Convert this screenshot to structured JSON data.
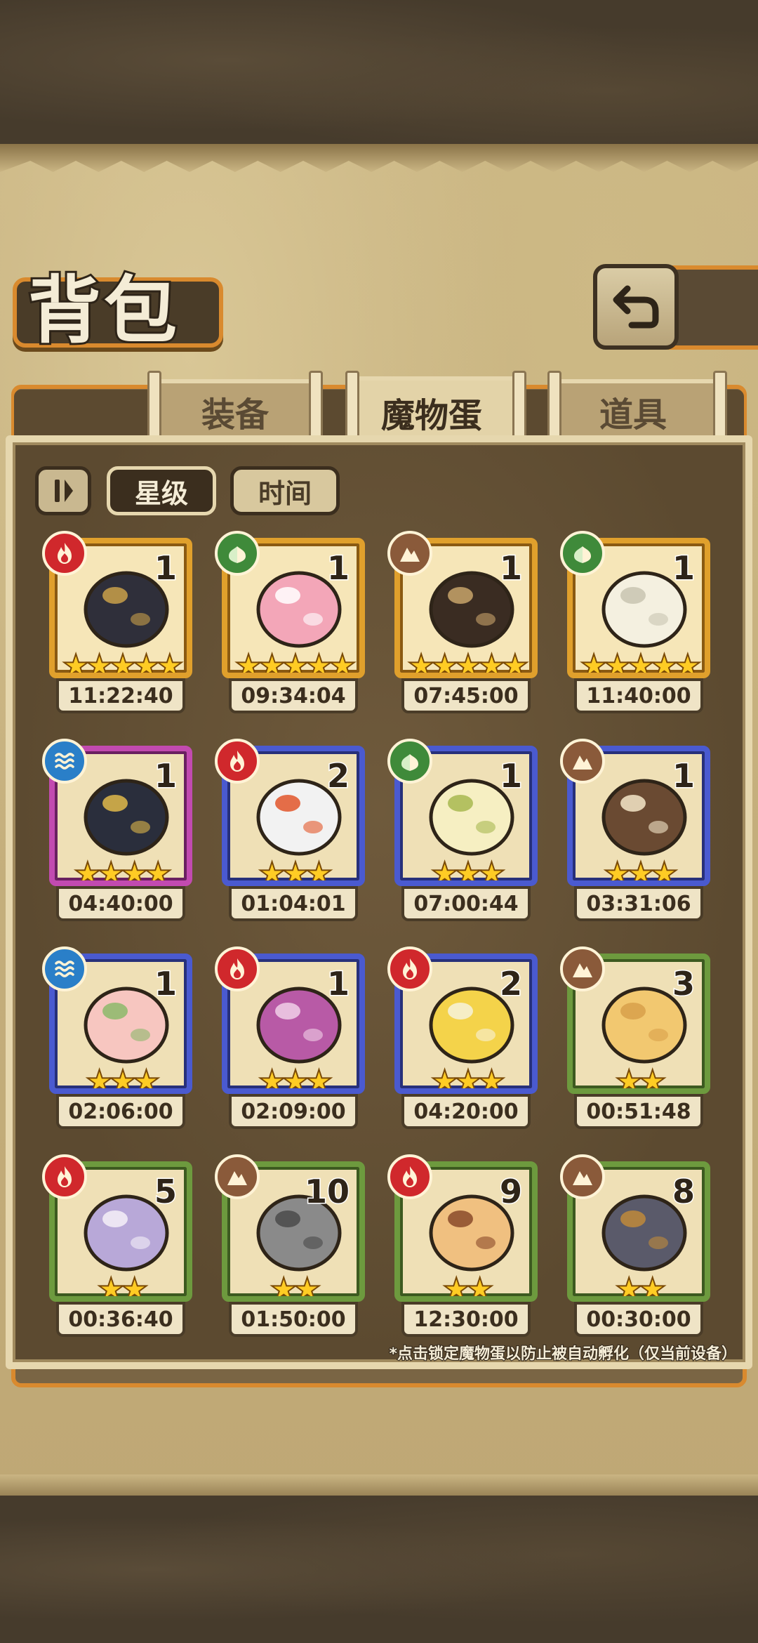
{
  "header": {
    "title": "背包",
    "back_icon": "back-arrow-icon"
  },
  "tabs": [
    {
      "label": "装备",
      "active": false
    },
    {
      "label": "魔物蛋",
      "active": true
    },
    {
      "label": "道具",
      "active": false
    }
  ],
  "sort": {
    "toggle_icon": "sort-order-icon",
    "star_label": "星级",
    "time_label": "时间",
    "selected": "星级"
  },
  "colors": {
    "fire": "#d0282c",
    "leaf": "#3f8a3a",
    "earth": "#8a5a3a",
    "water": "#2a7fc8",
    "accent": "#d98a2e"
  },
  "eggs": [
    {
      "element": "fire",
      "count": "1",
      "stars": "★★★★★",
      "time": "11:22:40",
      "rarity": "gold"
    },
    {
      "element": "leaf",
      "count": "1",
      "stars": "★★★★★",
      "time": "09:34:04",
      "rarity": "gold"
    },
    {
      "element": "earth",
      "count": "1",
      "stars": "★★★★★",
      "time": "07:45:00",
      "rarity": "gold"
    },
    {
      "element": "leaf",
      "count": "1",
      "stars": "★★★★★",
      "time": "11:40:00",
      "rarity": "gold"
    },
    {
      "element": "water",
      "count": "1",
      "stars": "★★★★",
      "time": "04:40:00",
      "rarity": "purple"
    },
    {
      "element": "fire",
      "count": "2",
      "stars": "★★★",
      "time": "01:04:01",
      "rarity": "blue"
    },
    {
      "element": "leaf",
      "count": "1",
      "stars": "★★★",
      "time": "07:00:44",
      "rarity": "blue"
    },
    {
      "element": "earth",
      "count": "1",
      "stars": "★★★",
      "time": "03:31:06",
      "rarity": "blue"
    },
    {
      "element": "water",
      "count": "1",
      "stars": "★★★",
      "time": "02:06:00",
      "rarity": "blue"
    },
    {
      "element": "fire",
      "count": "1",
      "stars": "★★★",
      "time": "02:09:00",
      "rarity": "blue"
    },
    {
      "element": "fire",
      "count": "2",
      "stars": "★★★",
      "time": "04:20:00",
      "rarity": "blue"
    },
    {
      "element": "earth",
      "count": "3",
      "stars": "★★",
      "time": "00:51:48",
      "rarity": "green"
    },
    {
      "element": "fire",
      "count": "5",
      "stars": "★★",
      "time": "00:36:40",
      "rarity": "green"
    },
    {
      "element": "earth",
      "count": "10",
      "stars": "★★",
      "time": "01:50:00",
      "rarity": "green"
    },
    {
      "element": "fire",
      "count": "9",
      "stars": "★★",
      "time": "12:30:00",
      "rarity": "green"
    },
    {
      "element": "earth",
      "count": "8",
      "stars": "★★",
      "time": "00:30:00",
      "rarity": "green"
    }
  ],
  "footnote": "*点击锁定魔物蛋以防止被自动孵化（仅当前设备）"
}
